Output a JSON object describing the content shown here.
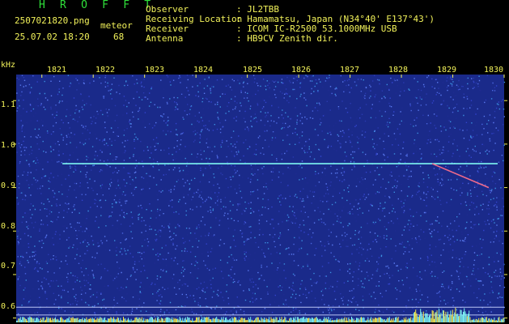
{
  "header": {
    "app_title": "H R O F F T",
    "filename": "2507021820.png",
    "datetime": "25.07.02 18:20",
    "meteor_label": "meteor",
    "meteor_count": "68",
    "info_labels": [
      "Observer",
      "Receiving Location",
      "Receiver",
      "Antenna"
    ],
    "info_values": [
      ": JL2TBB",
      ": Hamamatsu, Japan (N34°40' E137°43')",
      ": ICOM IC-R2500 53.1000MHz USB",
      ": HB9CV Zenith dir."
    ]
  },
  "colors": {
    "title_green": "#2fe03a",
    "label_yellow": "#f2f25a",
    "text_white": "#f0f0f0",
    "spectrogram_bg": "#1a2a8a",
    "trace_cyan": "#7ef7f2",
    "signal_yellow": "#f5e84a"
  },
  "chart_data": {
    "type": "heatmap",
    "ylabel": "kHz",
    "x_ticks": [
      "1821",
      "1822",
      "1823",
      "1824",
      "1825",
      "1826",
      "1827",
      "1828",
      "1829",
      "1830"
    ],
    "y_ticks": [
      "1.1",
      "1.0",
      "0.9",
      "0.8",
      "0.7",
      "0.6"
    ],
    "xlim": [
      1820.5,
      1830
    ],
    "ylim": [
      0.59,
      1.16
    ],
    "carrier_line_khz": 0.955,
    "reference_lines_khz": [
      0.625,
      0.607
    ],
    "meteor_trail": {
      "x_start": 1828.6,
      "x_end": 1829.7,
      "khz_start": 0.955,
      "khz_end": 0.9
    }
  }
}
